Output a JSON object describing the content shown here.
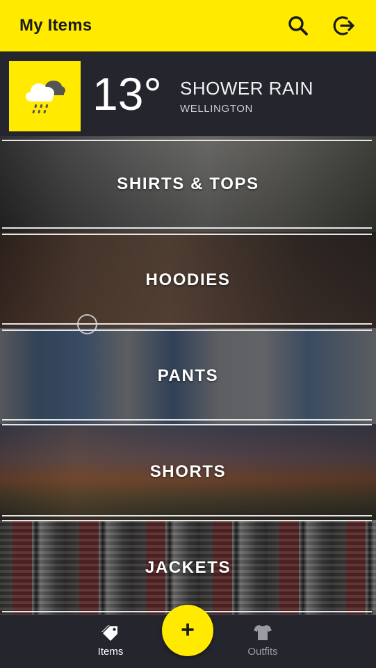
{
  "header": {
    "title": "My Items",
    "icons": {
      "search": "search-icon",
      "logout": "logout-icon"
    },
    "background": "#ffea00"
  },
  "weather": {
    "icon": "rain-cloud-icon",
    "temperature": "13°",
    "condition": "SHOWER RAIN",
    "city": "WELLINGTON"
  },
  "categories": [
    {
      "label": "SHIRTS & TOPS"
    },
    {
      "label": "HOODIES"
    },
    {
      "label": "PANTS"
    },
    {
      "label": "SHORTS"
    },
    {
      "label": "JACKETS"
    }
  ],
  "bottom_nav": {
    "items_label": "Items",
    "items_icon": "tag-icon",
    "outfits_label": "Outfits",
    "outfits_icon": "tshirt-icon",
    "fab_label": "+",
    "fab_icon": "plus-icon"
  },
  "colors": {
    "accent": "#ffea00",
    "panel": "#24252d",
    "nav_active": "#ffffff",
    "nav_inactive": "#9a9ba3"
  }
}
